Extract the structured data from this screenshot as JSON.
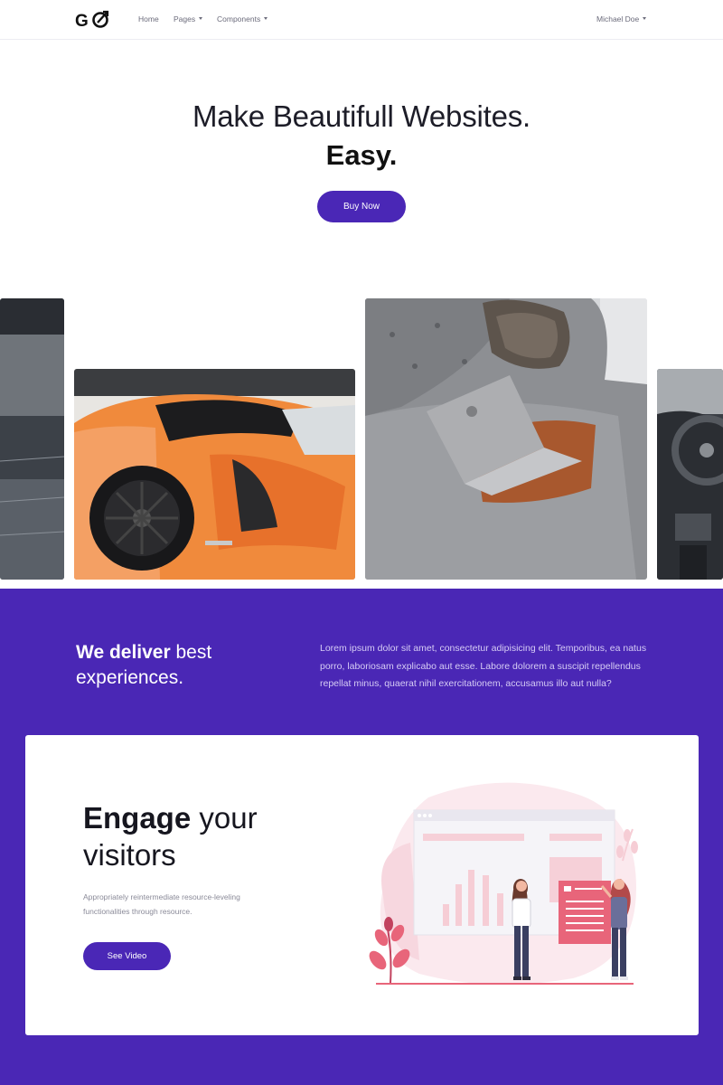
{
  "nav": {
    "logo_text": "GO",
    "items": [
      {
        "label": "Home"
      },
      {
        "label": "Pages"
      },
      {
        "label": "Components"
      }
    ],
    "user": "Michael Doe"
  },
  "hero": {
    "title": "Make Beautifull Websites.",
    "subtitle": "Easy.",
    "button": "Buy Now"
  },
  "gallery": {
    "images": [
      {
        "name": "dark-building-photo"
      },
      {
        "name": "orange-sports-car-photo"
      },
      {
        "name": "laptop-on-sofa-photo"
      },
      {
        "name": "car-interior-photo"
      }
    ]
  },
  "deliver": {
    "title_bold": "We deliver",
    "title_rest": " best experiences.",
    "text": "Lorem ipsum dolor sit amet, consectetur adipisicing elit. Temporibus, ea natus porro, laboriosam explicabo aut esse. Labore dolorem a suscipit repellendus repellat minus, quaerat nihil exercitationem, accusamus illo aut nulla?"
  },
  "engage": {
    "title_bold": "Engage",
    "title_rest": " your visitors",
    "text": "Appropriately reintermediate resource-leveling functionalities through resource.",
    "button": "See Video"
  },
  "colors": {
    "primary": "#4a27b6",
    "accent_pink": "#e8657a"
  }
}
